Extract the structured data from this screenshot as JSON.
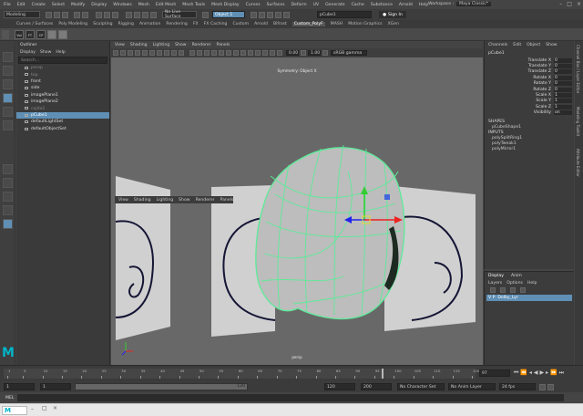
{
  "menu": [
    "File",
    "Edit",
    "Create",
    "Select",
    "Modify",
    "Display",
    "Windows",
    "Mesh",
    "Edit Mesh",
    "Mesh Tools",
    "Mesh Display",
    "Curves",
    "Surfaces",
    "Deform",
    "UV",
    "Generate",
    "Cache",
    "Substance",
    "Arnold",
    "Help"
  ],
  "workspace": {
    "label": "Workspace :",
    "value": "Maya Classic*"
  },
  "status": {
    "mode": "Modeling",
    "live_surface": "No Live Surface",
    "object_field": "Object 1",
    "name_field": "pCube1",
    "sign_in": "Sign In"
  },
  "shelf_tabs": [
    "Curves / Surfaces",
    "Poly Modeling",
    "Sculpting",
    "Rigging",
    "Animation",
    "Rendering",
    "FX",
    "FX Caching",
    "Custom",
    "Arnold",
    "Bifrost",
    "Custom_PolyF",
    "MASH",
    "Motion Graphics",
    "XGen"
  ],
  "shelf_active": "Custom_PolyF",
  "shelf_labels": [
    "Vol",
    "FT",
    "CP"
  ],
  "outliner": {
    "title": "Outliner",
    "menu": [
      "Display",
      "Show",
      "Help"
    ],
    "search_placeholder": "Search...",
    "items": [
      {
        "label": "persp",
        "state": "dim"
      },
      {
        "label": "top",
        "state": "dim"
      },
      {
        "label": "front",
        "state": "normal"
      },
      {
        "label": "side",
        "state": "normal"
      },
      {
        "label": "imagePlane1",
        "state": "normal"
      },
      {
        "label": "imagePlane2",
        "state": "normal"
      },
      {
        "label": "cajita1",
        "state": "dim"
      },
      {
        "label": "pCube1",
        "state": "sel"
      },
      {
        "label": "defaultLightSet",
        "state": "normal"
      },
      {
        "label": "defaultObjectSet",
        "state": "normal"
      }
    ]
  },
  "viewport": {
    "menu": [
      "View",
      "Shading",
      "Lighting",
      "Show",
      "Renderer",
      "Panels"
    ],
    "inner_menu": [
      "View",
      "Shading",
      "Lighting",
      "Show",
      "Renderer",
      "Panels"
    ],
    "symmetry": "Symmetry: Object X",
    "camera": "persp",
    "field_a": "0.00",
    "field_b": "1.00",
    "colorspace": "sRGB gamma"
  },
  "channel_box": {
    "menu": [
      "Channels",
      "Edit",
      "Object",
      "Show"
    ],
    "object": "pCube1",
    "attrs": [
      {
        "label": "Translate X",
        "value": "0"
      },
      {
        "label": "Translate Y",
        "value": "0"
      },
      {
        "label": "Translate Z",
        "value": "0"
      },
      {
        "label": "Rotate X",
        "value": "0"
      },
      {
        "label": "Rotate Y",
        "value": "0"
      },
      {
        "label": "Rotate Z",
        "value": "0"
      },
      {
        "label": "Scale X",
        "value": "1"
      },
      {
        "label": "Scale Y",
        "value": "1"
      },
      {
        "label": "Scale Z",
        "value": "1"
      },
      {
        "label": "Visibility",
        "value": "on"
      }
    ],
    "shapes_header": "SHAPES",
    "shapes": [
      "pCubeShape1"
    ],
    "inputs_header": "INPUTS",
    "inputs": [
      "polySplitRing1",
      "polyTweak1",
      "polyMirror1"
    ]
  },
  "layers": {
    "tabs": [
      "Display",
      "Anim"
    ],
    "menu": [
      "Layers",
      "Options",
      "Help"
    ],
    "row": "V  P",
    "layer_name": "Dolby_Lyr"
  },
  "side_tabs": [
    "Channel Box / Layer Editor",
    "Modeling Toolkit",
    "Attribute Editor"
  ],
  "timeline": {
    "ticks": [
      "1",
      "5",
      "10",
      "15",
      "20",
      "25",
      "30",
      "35",
      "40",
      "45",
      "50",
      "55",
      "60",
      "65",
      "70",
      "75",
      "80",
      "85",
      "90",
      "95",
      "100",
      "105",
      "110",
      "115",
      "120"
    ],
    "current": "97"
  },
  "range": {
    "start": "1",
    "inner_start": "1",
    "slider_value": "120",
    "end_inner": "120",
    "end": "200",
    "char_set": "No Character Set",
    "anim_layer": "No Anim Layer",
    "fps": "24 fps"
  },
  "mel": {
    "label": "MEL"
  },
  "colors": {
    "selection": "#5f8fb5",
    "wire": "#5eea98",
    "viewport_bg": "#686868",
    "maya_logo": "#00b4c8"
  }
}
